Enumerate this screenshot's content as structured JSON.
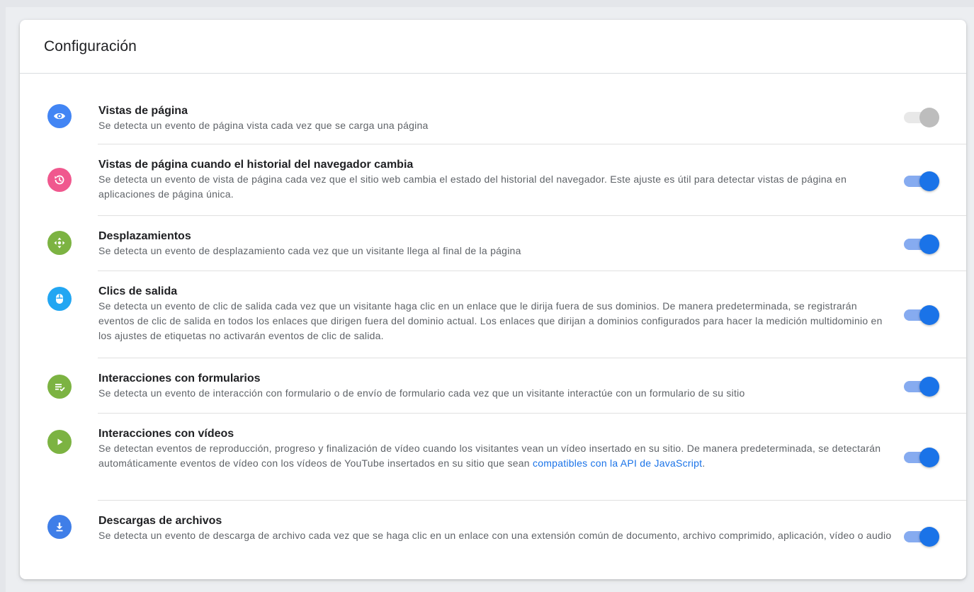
{
  "header": {
    "title": "Configuración"
  },
  "colors": {
    "accent": "#1a73e8",
    "link": "#1a73e8",
    "toggle_on_thumb": "#1a73e8",
    "toggle_on_track": "#86abf0",
    "toggle_off_thumb": "#bdbdbd",
    "toggle_off_track": "#e8e8e8"
  },
  "settings": [
    {
      "title": "Vistas de página",
      "description": "Se detecta un evento de página vista cada vez que se carga una página",
      "icon": "eye-icon",
      "icon_color": "#4285f4",
      "enabled": false
    },
    {
      "title": "Vistas de página cuando el historial del navegador cambia",
      "description": "Se detecta un evento de vista de página cada vez que el sitio web cambia el estado del historial del navegador. Este ajuste es útil para detectar vistas de página en aplicaciones de página única.",
      "icon": "history-icon",
      "icon_color": "#f0588e",
      "enabled": true
    },
    {
      "title": "Desplazamientos",
      "description": "Se detecta un evento de desplazamiento cada vez que un visitante llega al final de la página",
      "icon": "move-arrows-icon",
      "icon_color": "#7cb342",
      "enabled": true
    },
    {
      "title": "Clics de salida",
      "description": "Se detecta un evento de clic de salida cada vez que un visitante haga clic en un enlace que le dirija fuera de sus dominios. De manera predeterminada, se registrarán eventos de clic de salida en todos los enlaces que dirigen fuera del dominio actual. Los enlaces que dirijan a dominios configurados para hacer la medición multidominio en los ajustes de etiquetas no activarán eventos de clic de salida.",
      "icon": "mouse-icon",
      "icon_color": "#22a6f2",
      "enabled": true
    },
    {
      "title": "Interacciones con formularios",
      "description": "Se detecta un evento de interacción con formulario o de envío de formulario cada vez que un visitante interactúe con un formulario de su sitio",
      "icon": "form-check-icon",
      "icon_color": "#7cb342",
      "enabled": true
    },
    {
      "title": "Interacciones con vídeos",
      "description": "Se detectan eventos de reproducción, progreso y finalización de vídeo cuando los visitantes vean un vídeo insertado en su sitio. De manera predeterminada, se detectarán automáticamente eventos de vídeo con los vídeos de YouTube insertados en su sitio que sean ",
      "link_text": "compatibles con la API de JavaScript",
      "description_end": ".",
      "icon": "play-icon",
      "icon_color": "#7cb342",
      "enabled": true
    },
    {
      "title": "Descargas de archivos",
      "description": "Se detecta un evento de descarga de archivo cada vez que se haga clic en un enlace con una extensión común de documento, archivo comprimido, aplicación, vídeo o audio",
      "icon": "download-icon",
      "icon_color": "#3f7ee8",
      "enabled": true
    }
  ]
}
